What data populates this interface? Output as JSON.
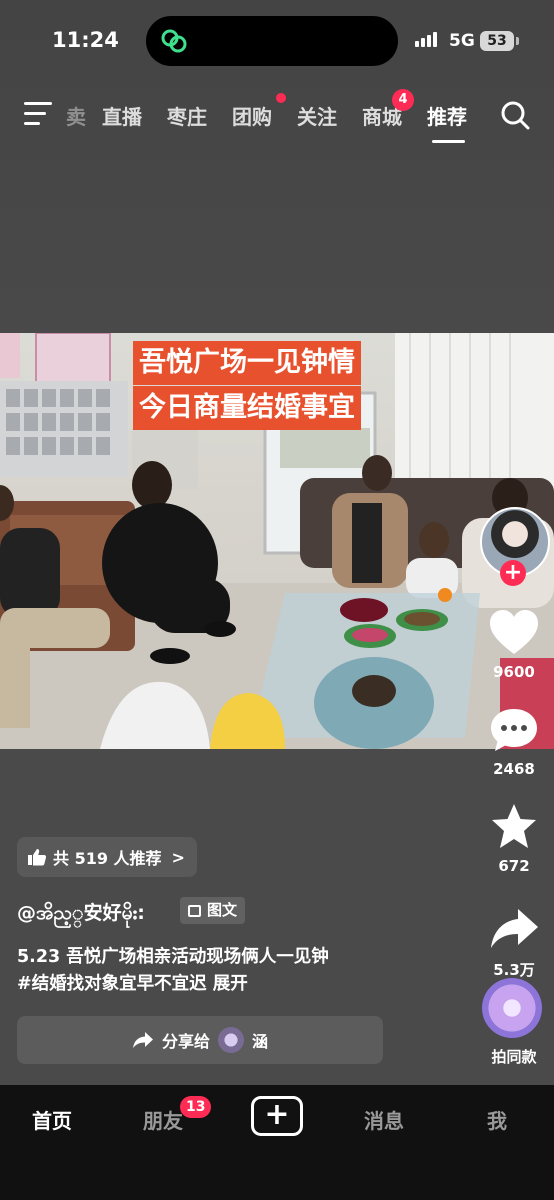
{
  "status_bar": {
    "time": "11:24",
    "network": "5G",
    "battery": "53"
  },
  "top_nav": {
    "items": [
      {
        "label": "卖",
        "state": "faded"
      },
      {
        "label": "直播"
      },
      {
        "label": "枣庄"
      },
      {
        "label": "团购",
        "dot": true
      },
      {
        "label": "关注"
      },
      {
        "label": "商城",
        "badge": "4"
      },
      {
        "label": "推荐",
        "state": "active"
      }
    ]
  },
  "video": {
    "caption_line1": "吾悦广场一见钟情",
    "caption_line2": "今日商量结婚事宜"
  },
  "actions": {
    "follow_label": "+",
    "likes": "9600",
    "comments": "2468",
    "favorites": "672",
    "shares": "5.3万",
    "same_style_label": "拍同款"
  },
  "post": {
    "recommend_text": "共 519 人推荐",
    "recommend_chevron": ">",
    "author": "@အိည့္安好မိုး:",
    "type_tag": "图文",
    "description_line1": "5.23 吾悦广场相亲活动现场俩人一见钟",
    "description_line2": "#结婚找对象宜早不宜迟  展开",
    "share_label": "分享给",
    "share_friend": "涵"
  },
  "tab_bar": {
    "home": "首页",
    "friends": "朋友",
    "friends_badge": "13",
    "create": "+",
    "messages": "消息",
    "me": "我"
  },
  "colors": {
    "accent": "#fe2c55",
    "caption_bg": "#e8512d",
    "tabbar_bg": "#111111"
  }
}
